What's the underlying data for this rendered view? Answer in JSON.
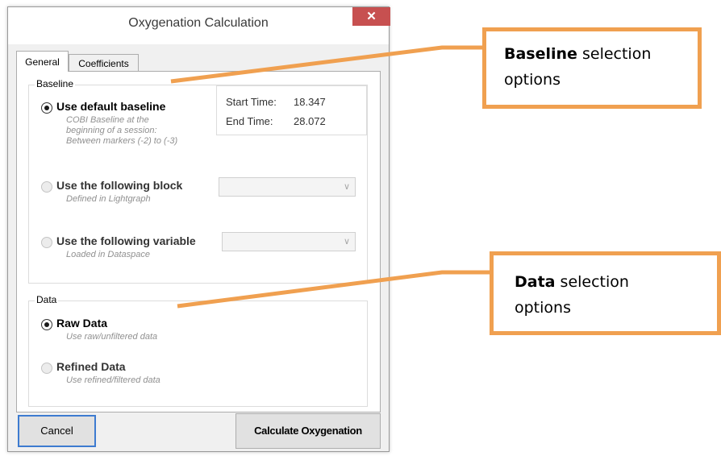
{
  "dialog": {
    "title": "Oxygenation Calculation",
    "close_glyph": "✕"
  },
  "tabs": [
    {
      "label": "General",
      "selected": true
    },
    {
      "label": "Coefficients",
      "selected": false
    }
  ],
  "baseline": {
    "group_label": "Baseline",
    "start_label": "Start Time:",
    "start_value": "18.347",
    "end_label": "End Time:",
    "end_value": "28.072",
    "options": [
      {
        "label": "Use default baseline",
        "checked": true,
        "enabled": true,
        "desc": [
          "COBI Baseline at the",
          "beginning of a session:",
          "Between markers (-2) to (-3)"
        ]
      },
      {
        "label": "Use the following block",
        "checked": false,
        "enabled": false,
        "desc": [
          "Defined in Lightgraph"
        ]
      },
      {
        "label": "Use the following variable",
        "checked": false,
        "enabled": false,
        "desc": [
          "Loaded in Dataspace"
        ]
      }
    ]
  },
  "data_group": {
    "group_label": "Data",
    "options": [
      {
        "label": "Raw Data",
        "checked": true,
        "enabled": true,
        "desc": "Use raw/unfiltered data"
      },
      {
        "label": "Refined Data",
        "checked": false,
        "enabled": false,
        "desc": "Use refined/filtered data"
      }
    ]
  },
  "buttons": {
    "cancel": "Cancel",
    "calculate": "Calculate Oxygenation"
  },
  "callouts": {
    "baseline": {
      "bold": "Baseline",
      "rest1": " selection",
      "line2": "options"
    },
    "data": {
      "bold": "Data",
      "rest1": " selection",
      "line2": "options"
    }
  },
  "colors": {
    "callout_accent": "#f0a050",
    "close_button": "#c75050",
    "focus_border": "#3d7bd0"
  },
  "icons": {
    "close": "close-icon",
    "dropdown": "chevron-down-icon"
  }
}
